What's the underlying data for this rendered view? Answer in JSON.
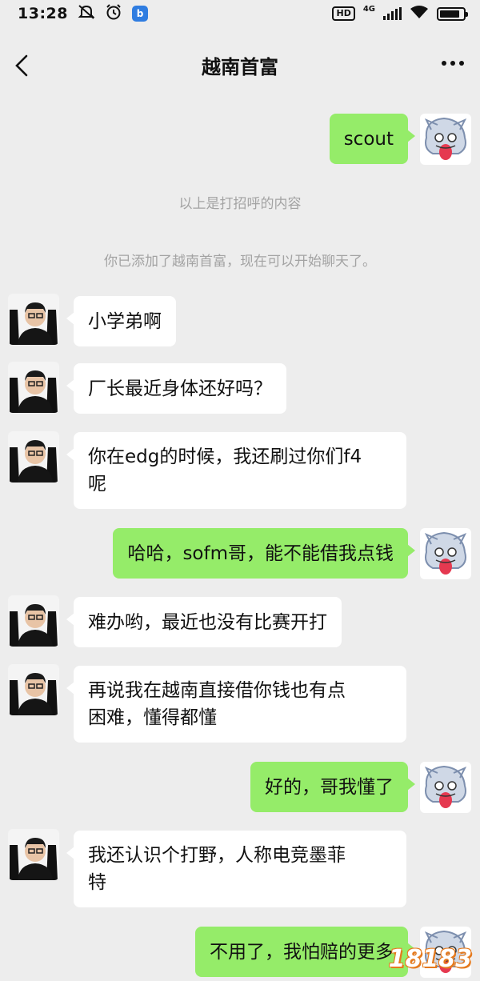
{
  "status_bar": {
    "time": "13:28",
    "app_badge": "b",
    "hd": "HD",
    "network": "4G",
    "battery_level": 0.85
  },
  "header": {
    "title": "越南首富"
  },
  "messages": [
    {
      "side": "right",
      "text": "scout"
    },
    {
      "side": "left",
      "text": "小学弟啊"
    },
    {
      "side": "left",
      "text": "厂长最近身体还好吗？"
    },
    {
      "side": "left",
      "text": "你在edg的时候，我还刷过你们f4\n呢"
    },
    {
      "side": "right",
      "text": "哈哈，sofm哥，能不能借我点钱"
    },
    {
      "side": "left",
      "text": "难办哟，最近也没有比赛开打"
    },
    {
      "side": "left",
      "text": "再说我在越南直接借你钱也有点\n困难，懂得都懂"
    },
    {
      "side": "right",
      "text": "好的，哥我懂了"
    },
    {
      "side": "left",
      "text": "我还认识个打野，人称电竞墨菲\n特"
    },
    {
      "side": "right",
      "text": "不用了，我怕赔的更多"
    }
  ],
  "system_notes": {
    "greeting_note": "以上是打招呼的内容",
    "added_note": "你已添加了越南首富，现在可以开始聊天了。"
  },
  "watermark": "18183"
}
